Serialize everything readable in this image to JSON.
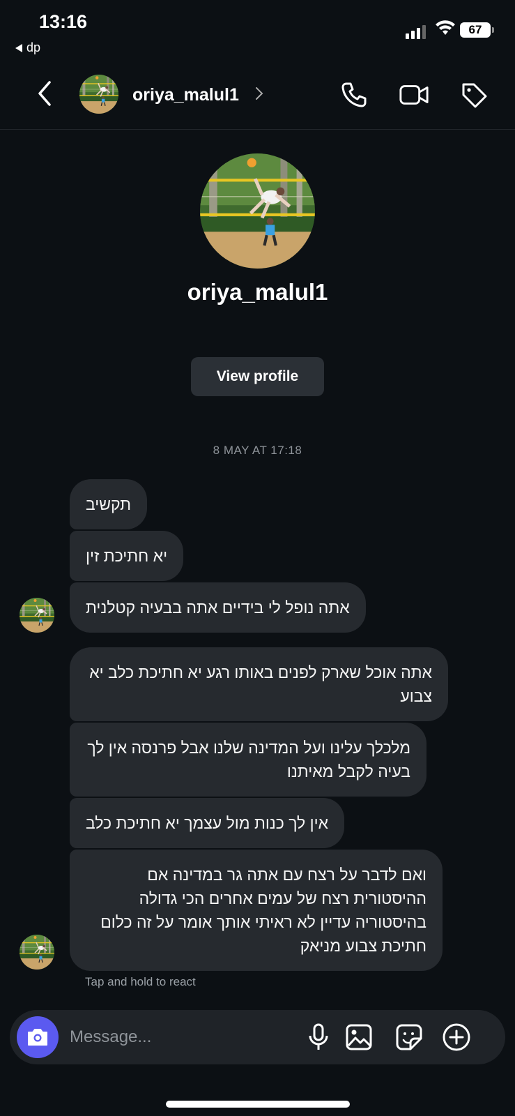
{
  "status_bar": {
    "time": "13:16",
    "back_app": "dp",
    "battery": "67"
  },
  "header": {
    "username": "oriya_malul1",
    "icons": [
      "back-chevron-icon",
      "chevron-right-icon",
      "phone-icon",
      "video-camera-icon",
      "tag-icon"
    ]
  },
  "profile": {
    "username": "oriya_malul1",
    "view_profile_label": "View profile"
  },
  "thread": {
    "timestamp": "8 MAY AT 17:18",
    "messages": [
      "תקשיב",
      "יא חתיכת זין",
      "אתה נופל לי בידיים אתה בבעיה קטלנית",
      "אתה אוכל שארק לפנים באותו רגע יא חתיכת כלב יא צבוע",
      "מלכלך עלינו ועל המדינה שלנו אבל פרנסה אין לך בעיה לקבל מאיתנו",
      "אין לך כנות מול עצמך יא חתיכת כלב",
      "ואם לדבר על רצח עם אתה גר במדינה אם ההיסטורית רצח של עמים אחרים הכי גדולה בהיסטוריה עדיין לא ראיתי אותך אומר על זה כלום חתיכת צבוע מניאק"
    ],
    "react_hint": "Tap and hold to react"
  },
  "composer": {
    "placeholder": "Message...",
    "icons": [
      "camera-icon",
      "microphone-icon",
      "gallery-icon",
      "sticker-icon",
      "plus-icon"
    ]
  },
  "colors": {
    "background": "#0c1014",
    "bubble": "#262a2f",
    "accent": "#5b5af0"
  }
}
